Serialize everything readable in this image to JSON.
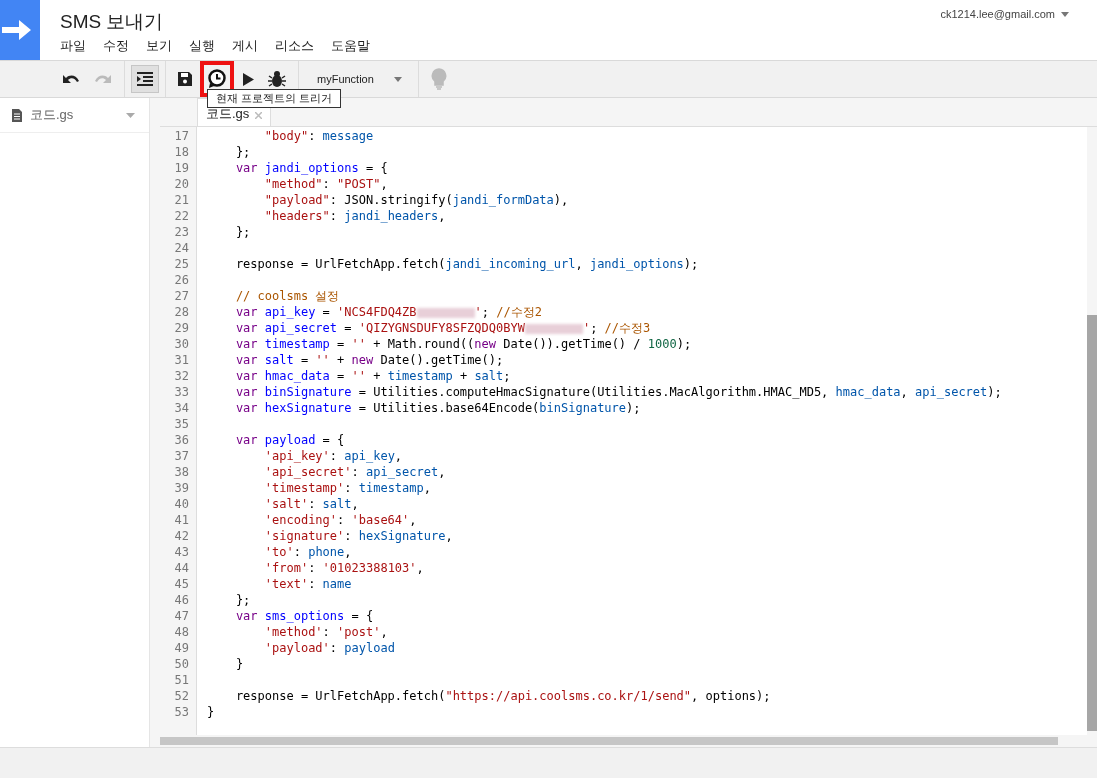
{
  "header": {
    "title": "SMS 보내기",
    "menu": [
      "파일",
      "수정",
      "보기",
      "실행",
      "게시",
      "리소스",
      "도움말"
    ],
    "account": "ck1214.lee@gmail.com"
  },
  "toolbar": {
    "undo_disabled": false,
    "redo_disabled": true,
    "auto_indent_on": true,
    "triggers_highlighted": true,
    "function_select": "myFunction",
    "lightbulb_disabled": true,
    "tooltip": "현재 프로젝트의 트리거"
  },
  "sidebar": {
    "files": [
      "코드.gs"
    ]
  },
  "tabs": [
    {
      "label": "코드.gs",
      "selected": true
    }
  ],
  "code_lines": [
    {
      "number": "17",
      "tokens": [
        {
          "kind": "string",
          "text": "        \"body\""
        },
        {
          "kind": "plain",
          "text": ": "
        },
        {
          "kind": "variable",
          "text": "message"
        }
      ]
    },
    {
      "number": "18",
      "tokens": [
        {
          "kind": "plain",
          "text": "    };"
        }
      ]
    },
    {
      "number": "19",
      "tokens": [
        {
          "kind": "keyword",
          "text": "    var "
        },
        {
          "kind": "def",
          "text": "jandi_options"
        },
        {
          "kind": "plain",
          "text": " = {"
        }
      ]
    },
    {
      "number": "20",
      "tokens": [
        {
          "kind": "string",
          "text": "        \"method\""
        },
        {
          "kind": "plain",
          "text": ": "
        },
        {
          "kind": "string",
          "text": "\"POST\""
        },
        {
          "kind": "plain",
          "text": ","
        }
      ]
    },
    {
      "number": "21",
      "tokens": [
        {
          "kind": "string",
          "text": "        \"payload\""
        },
        {
          "kind": "plain",
          "text": ": JSON.stringify("
        },
        {
          "kind": "variable",
          "text": "jandi_formData"
        },
        {
          "kind": "plain",
          "text": "),"
        }
      ]
    },
    {
      "number": "22",
      "tokens": [
        {
          "kind": "string",
          "text": "        \"headers\""
        },
        {
          "kind": "plain",
          "text": ": "
        },
        {
          "kind": "variable",
          "text": "jandi_headers"
        },
        {
          "kind": "plain",
          "text": ","
        }
      ]
    },
    {
      "number": "23",
      "tokens": [
        {
          "kind": "plain",
          "text": "    };"
        }
      ]
    },
    {
      "number": "24"
    },
    {
      "number": "25",
      "tokens": [
        {
          "kind": "plain",
          "text": "    response = UrlFetchApp.fetch("
        },
        {
          "kind": "variable",
          "text": "jandi_incoming_url"
        },
        {
          "kind": "plain",
          "text": ", "
        },
        {
          "kind": "variable",
          "text": "jandi_options"
        },
        {
          "kind": "plain",
          "text": ");"
        }
      ]
    },
    {
      "number": "26"
    },
    {
      "number": "27",
      "tokens": [
        {
          "kind": "comment",
          "text": "    // coolsms 설정"
        }
      ]
    },
    {
      "number": "28",
      "tokens": [
        {
          "kind": "keyword",
          "text": "    var "
        },
        {
          "kind": "def",
          "text": "api_key"
        },
        {
          "kind": "plain",
          "text": " = "
        },
        {
          "kind": "string",
          "text": "'NCS4FDQ4ZB"
        },
        {
          "kind": "redacted"
        },
        {
          "kind": "string",
          "text": "'"
        },
        {
          "kind": "plain",
          "text": ";"
        },
        {
          "kind": "comment",
          "text": " //수정2"
        }
      ]
    },
    {
      "number": "29",
      "tokens": [
        {
          "kind": "keyword",
          "text": "    var "
        },
        {
          "kind": "def",
          "text": "api_secret"
        },
        {
          "kind": "plain",
          "text": " = "
        },
        {
          "kind": "string",
          "text": "'QIZYGNSDUFY8SFZQDQ0BYW"
        },
        {
          "kind": "redacted"
        },
        {
          "kind": "string",
          "text": "'"
        },
        {
          "kind": "plain",
          "text": ";"
        },
        {
          "kind": "comment",
          "text": " //수정3"
        }
      ]
    },
    {
      "number": "30",
      "tokens": [
        {
          "kind": "keyword",
          "text": "    var "
        },
        {
          "kind": "def",
          "text": "timestamp"
        },
        {
          "kind": "plain",
          "text": " = "
        },
        {
          "kind": "string",
          "text": "''"
        },
        {
          "kind": "plain",
          "text": " + Math.round(("
        },
        {
          "kind": "keyword",
          "text": "new"
        },
        {
          "kind": "plain",
          "text": " Date()).getTime() / "
        },
        {
          "kind": "number",
          "text": "1000"
        },
        {
          "kind": "plain",
          "text": ");"
        }
      ]
    },
    {
      "number": "31",
      "tokens": [
        {
          "kind": "keyword",
          "text": "    var "
        },
        {
          "kind": "def",
          "text": "salt"
        },
        {
          "kind": "plain",
          "text": " = "
        },
        {
          "kind": "string",
          "text": "''"
        },
        {
          "kind": "plain",
          "text": " + "
        },
        {
          "kind": "keyword",
          "text": "new"
        },
        {
          "kind": "plain",
          "text": " Date().getTime();"
        }
      ]
    },
    {
      "number": "32",
      "tokens": [
        {
          "kind": "keyword",
          "text": "    var "
        },
        {
          "kind": "def",
          "text": "hmac_data"
        },
        {
          "kind": "plain",
          "text": " = "
        },
        {
          "kind": "string",
          "text": "''"
        },
        {
          "kind": "plain",
          "text": " + "
        },
        {
          "kind": "variable",
          "text": "timestamp"
        },
        {
          "kind": "plain",
          "text": " + "
        },
        {
          "kind": "variable",
          "text": "salt"
        },
        {
          "kind": "plain",
          "text": ";"
        }
      ]
    },
    {
      "number": "33",
      "tokens": [
        {
          "kind": "keyword",
          "text": "    var "
        },
        {
          "kind": "def",
          "text": "binSignature"
        },
        {
          "kind": "plain",
          "text": " = Utilities.computeHmacSignature(Utilities.MacAlgorithm.HMAC_MD5, "
        },
        {
          "kind": "variable",
          "text": "hmac_data"
        },
        {
          "kind": "plain",
          "text": ", "
        },
        {
          "kind": "variable",
          "text": "api_secret"
        },
        {
          "kind": "plain",
          "text": ");"
        }
      ]
    },
    {
      "number": "34",
      "tokens": [
        {
          "kind": "keyword",
          "text": "    var "
        },
        {
          "kind": "def",
          "text": "hexSignature"
        },
        {
          "kind": "plain",
          "text": " = Utilities.base64Encode("
        },
        {
          "kind": "variable",
          "text": "binSignature"
        },
        {
          "kind": "plain",
          "text": ");"
        }
      ]
    },
    {
      "number": "35"
    },
    {
      "number": "36",
      "tokens": [
        {
          "kind": "keyword",
          "text": "    var "
        },
        {
          "kind": "def",
          "text": "payload"
        },
        {
          "kind": "plain",
          "text": " = {"
        }
      ]
    },
    {
      "number": "37",
      "tokens": [
        {
          "kind": "string",
          "text": "        'api_key'"
        },
        {
          "kind": "plain",
          "text": ": "
        },
        {
          "kind": "variable",
          "text": "api_key"
        },
        {
          "kind": "plain",
          "text": ","
        }
      ]
    },
    {
      "number": "38",
      "tokens": [
        {
          "kind": "string",
          "text": "        'api_secret'"
        },
        {
          "kind": "plain",
          "text": ": "
        },
        {
          "kind": "variable",
          "text": "api_secret"
        },
        {
          "kind": "plain",
          "text": ","
        }
      ]
    },
    {
      "number": "39",
      "tokens": [
        {
          "kind": "string",
          "text": "        'timestamp'"
        },
        {
          "kind": "plain",
          "text": ": "
        },
        {
          "kind": "variable",
          "text": "timestamp"
        },
        {
          "kind": "plain",
          "text": ","
        }
      ]
    },
    {
      "number": "40",
      "tokens": [
        {
          "kind": "string",
          "text": "        'salt'"
        },
        {
          "kind": "plain",
          "text": ": "
        },
        {
          "kind": "variable",
          "text": "salt"
        },
        {
          "kind": "plain",
          "text": ","
        }
      ]
    },
    {
      "number": "41",
      "tokens": [
        {
          "kind": "string",
          "text": "        'encoding'"
        },
        {
          "kind": "plain",
          "text": ": "
        },
        {
          "kind": "string",
          "text": "'base64'"
        },
        {
          "kind": "plain",
          "text": ","
        }
      ]
    },
    {
      "number": "42",
      "tokens": [
        {
          "kind": "string",
          "text": "        'signature'"
        },
        {
          "kind": "plain",
          "text": ": "
        },
        {
          "kind": "variable",
          "text": "hexSignature"
        },
        {
          "kind": "plain",
          "text": ","
        }
      ]
    },
    {
      "number": "43",
      "tokens": [
        {
          "kind": "string",
          "text": "        'to'"
        },
        {
          "kind": "plain",
          "text": ": "
        },
        {
          "kind": "variable",
          "text": "phone"
        },
        {
          "kind": "plain",
          "text": ","
        }
      ]
    },
    {
      "number": "44",
      "tokens": [
        {
          "kind": "string",
          "text": "        'from'"
        },
        {
          "kind": "plain",
          "text": ": "
        },
        {
          "kind": "string",
          "text": "'01023388103'"
        },
        {
          "kind": "plain",
          "text": ","
        }
      ]
    },
    {
      "number": "45",
      "tokens": [
        {
          "kind": "string",
          "text": "        'text'"
        },
        {
          "kind": "plain",
          "text": ": "
        },
        {
          "kind": "variable",
          "text": "name"
        }
      ]
    },
    {
      "number": "46",
      "tokens": [
        {
          "kind": "plain",
          "text": "    };"
        }
      ]
    },
    {
      "number": "47",
      "tokens": [
        {
          "kind": "keyword",
          "text": "    var "
        },
        {
          "kind": "def",
          "text": "sms_options"
        },
        {
          "kind": "plain",
          "text": " = {"
        }
      ]
    },
    {
      "number": "48",
      "tokens": [
        {
          "kind": "string",
          "text": "        'method'"
        },
        {
          "kind": "plain",
          "text": ": "
        },
        {
          "kind": "string",
          "text": "'post'"
        },
        {
          "kind": "plain",
          "text": ","
        }
      ]
    },
    {
      "number": "49",
      "tokens": [
        {
          "kind": "string",
          "text": "        'payload'"
        },
        {
          "kind": "plain",
          "text": ": "
        },
        {
          "kind": "variable",
          "text": "payload"
        }
      ]
    },
    {
      "number": "50",
      "tokens": [
        {
          "kind": "plain",
          "text": "    }"
        }
      ]
    },
    {
      "number": "51"
    },
    {
      "number": "52",
      "tokens": [
        {
          "kind": "plain",
          "text": "    response = UrlFetchApp.fetch("
        },
        {
          "kind": "string",
          "text": "\"https://api.coolsms.co.kr/1/send\""
        },
        {
          "kind": "plain",
          "text": ", options);"
        }
      ]
    },
    {
      "number": "53",
      "tokens": [
        {
          "kind": "plain",
          "text": "}"
        }
      ]
    }
  ]
}
